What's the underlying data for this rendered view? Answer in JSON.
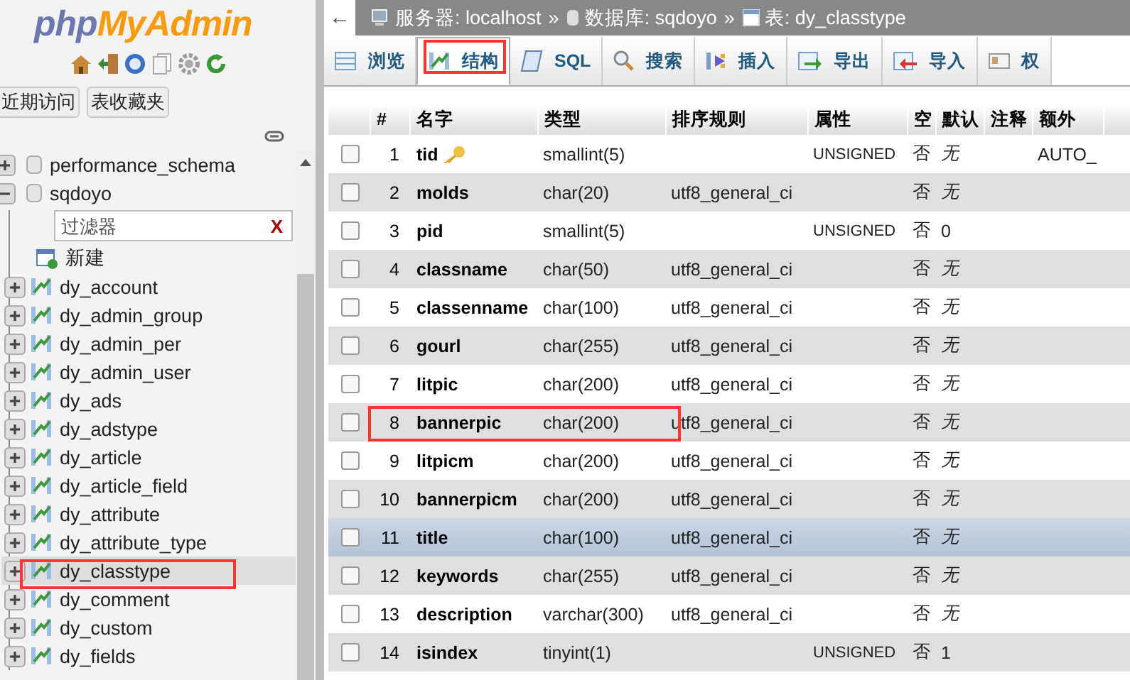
{
  "sidebar": {
    "logo": {
      "part_1": "php",
      "part_2": "MyAdmin"
    },
    "buttons": [
      {
        "label": "近期访问"
      },
      {
        "label": "表收藏夹"
      }
    ],
    "databases": [
      {
        "name": "performance_schema",
        "expanded": false
      },
      {
        "name": "sqdoyo",
        "expanded": true,
        "filter_placeholder": "过滤器",
        "clear": "X",
        "new_label": "新建",
        "tables": [
          {
            "name": "dy_account",
            "highlighted": false,
            "annotated": false
          },
          {
            "name": "dy_admin_group",
            "highlighted": false,
            "annotated": false
          },
          {
            "name": "dy_admin_per",
            "highlighted": false,
            "annotated": false
          },
          {
            "name": "dy_admin_user",
            "highlighted": false,
            "annotated": false
          },
          {
            "name": "dy_ads",
            "highlighted": false,
            "annotated": false
          },
          {
            "name": "dy_adstype",
            "highlighted": false,
            "annotated": false
          },
          {
            "name": "dy_article",
            "highlighted": false,
            "annotated": false
          },
          {
            "name": "dy_article_field",
            "highlighted": false,
            "annotated": false
          },
          {
            "name": "dy_attribute",
            "highlighted": false,
            "annotated": false
          },
          {
            "name": "dy_attribute_type",
            "highlighted": false,
            "annotated": false
          },
          {
            "name": "dy_classtype",
            "highlighted": true,
            "annotated": true
          },
          {
            "name": "dy_comment",
            "highlighted": false,
            "annotated": false
          },
          {
            "name": "dy_custom",
            "highlighted": false,
            "annotated": false
          },
          {
            "name": "dy_fields",
            "highlighted": false,
            "annotated": false
          }
        ]
      }
    ]
  },
  "breadcrumb": {
    "back": "←",
    "items": [
      {
        "kind": "server",
        "text": "服务器: localhost"
      },
      {
        "kind": "database",
        "text": "数据库: sqdoyo"
      },
      {
        "kind": "table",
        "text": "表: dy_classtype"
      }
    ],
    "separator": "»"
  },
  "tabs": [
    {
      "label": "浏览",
      "selected": false,
      "annotated": false
    },
    {
      "label": "结构",
      "selected": true,
      "annotated": true
    },
    {
      "label": "SQL",
      "selected": false,
      "annotated": false
    },
    {
      "label": "搜索",
      "selected": false,
      "annotated": false
    },
    {
      "label": "插入",
      "selected": false,
      "annotated": false
    },
    {
      "label": "导出",
      "selected": false,
      "annotated": false
    },
    {
      "label": "导入",
      "selected": false,
      "annotated": false
    },
    {
      "label": "权",
      "selected": false,
      "annotated": false
    }
  ],
  "table": {
    "columns": [
      "#",
      "名字",
      "类型",
      "排序规则",
      "属性",
      "空",
      "默认",
      "注释",
      "额外"
    ],
    "rows": [
      {
        "n": "1",
        "name": "tid",
        "primary": true,
        "type": "smallint(5)",
        "collation": "",
        "attributes": "UNSIGNED",
        "null": "否",
        "default": "无",
        "default_none": true,
        "extra": "AUTO_",
        "checked": false,
        "highlighted": false,
        "annotated": false
      },
      {
        "n": "2",
        "name": "molds",
        "primary": false,
        "type": "char(20)",
        "collation": "utf8_general_ci",
        "attributes": "",
        "null": "否",
        "default": "无",
        "default_none": true,
        "extra": "",
        "checked": false,
        "highlighted": false,
        "annotated": false
      },
      {
        "n": "3",
        "name": "pid",
        "primary": false,
        "type": "smallint(5)",
        "collation": "",
        "attributes": "UNSIGNED",
        "null": "否",
        "default": "0",
        "default_none": false,
        "extra": "",
        "checked": false,
        "highlighted": false,
        "annotated": false
      },
      {
        "n": "4",
        "name": "classname",
        "primary": false,
        "type": "char(50)",
        "collation": "utf8_general_ci",
        "attributes": "",
        "null": "否",
        "default": "无",
        "default_none": true,
        "extra": "",
        "checked": false,
        "highlighted": false,
        "annotated": false
      },
      {
        "n": "5",
        "name": "classenname",
        "primary": false,
        "type": "char(100)",
        "collation": "utf8_general_ci",
        "attributes": "",
        "null": "否",
        "default": "无",
        "default_none": true,
        "extra": "",
        "checked": false,
        "highlighted": false,
        "annotated": false
      },
      {
        "n": "6",
        "name": "gourl",
        "primary": false,
        "type": "char(255)",
        "collation": "utf8_general_ci",
        "attributes": "",
        "null": "否",
        "default": "无",
        "default_none": true,
        "extra": "",
        "checked": false,
        "highlighted": false,
        "annotated": false
      },
      {
        "n": "7",
        "name": "litpic",
        "primary": false,
        "type": "char(200)",
        "collation": "utf8_general_ci",
        "attributes": "",
        "null": "否",
        "default": "无",
        "default_none": true,
        "extra": "",
        "checked": false,
        "highlighted": false,
        "annotated": false
      },
      {
        "n": "8",
        "name": "bannerpic",
        "primary": false,
        "type": "char(200)",
        "collation": "utf8_general_ci",
        "attributes": "",
        "null": "否",
        "default": "无",
        "default_none": true,
        "extra": "",
        "checked": false,
        "highlighted": false,
        "annotated": true
      },
      {
        "n": "9",
        "name": "litpicm",
        "primary": false,
        "type": "char(200)",
        "collation": "utf8_general_ci",
        "attributes": "",
        "null": "否",
        "default": "无",
        "default_none": true,
        "extra": "",
        "checked": false,
        "highlighted": false,
        "annotated": false
      },
      {
        "n": "10",
        "name": "bannerpicm",
        "primary": false,
        "type": "char(200)",
        "collation": "utf8_general_ci",
        "attributes": "",
        "null": "否",
        "default": "无",
        "default_none": true,
        "extra": "",
        "checked": false,
        "highlighted": false,
        "annotated": false
      },
      {
        "n": "11",
        "name": "title",
        "primary": false,
        "type": "char(100)",
        "collation": "utf8_general_ci",
        "attributes": "",
        "null": "否",
        "default": "无",
        "default_none": true,
        "extra": "",
        "checked": false,
        "highlighted": true,
        "annotated": false
      },
      {
        "n": "12",
        "name": "keywords",
        "primary": false,
        "type": "char(255)",
        "collation": "utf8_general_ci",
        "attributes": "",
        "null": "否",
        "default": "无",
        "default_none": true,
        "extra": "",
        "checked": false,
        "highlighted": false,
        "annotated": false
      },
      {
        "n": "13",
        "name": "description",
        "primary": false,
        "type": "varchar(300)",
        "collation": "utf8_general_ci",
        "attributes": "",
        "null": "否",
        "default": "无",
        "default_none": true,
        "extra": "",
        "checked": false,
        "highlighted": false,
        "annotated": false
      },
      {
        "n": "14",
        "name": "isindex",
        "primary": false,
        "type": "tinyint(1)",
        "collation": "",
        "attributes": "UNSIGNED",
        "null": "否",
        "default": "1",
        "default_none": false,
        "extra": "",
        "checked": false,
        "highlighted": false,
        "annotated": false
      }
    ]
  }
}
